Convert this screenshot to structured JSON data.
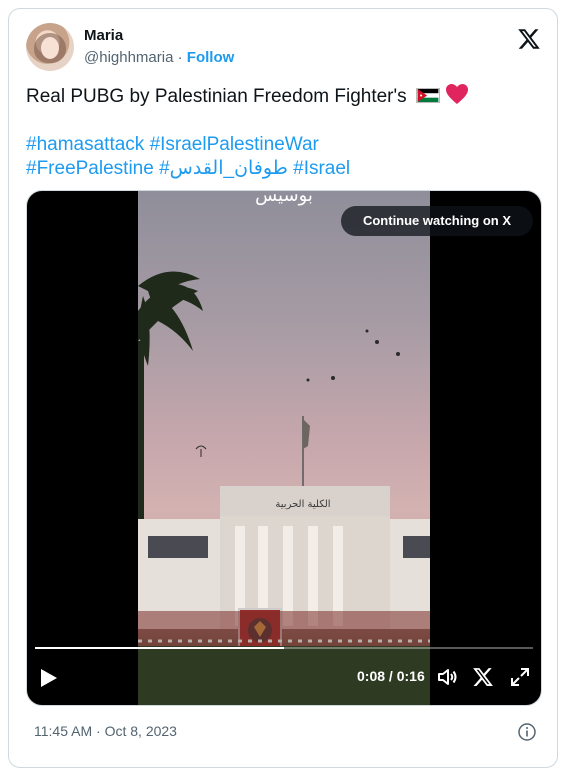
{
  "author": {
    "name": "Maria",
    "handle": "@highhmaria",
    "separator": "·",
    "follow_label": "Follow"
  },
  "icons": {
    "platform_logo": "x-logo-icon",
    "flag": "jordan-flag-icon",
    "heart": "red-heart-icon",
    "play": "play-icon",
    "volume": "volume-icon",
    "x_watermark": "x-logo-icon",
    "fullscreen": "fullscreen-icon",
    "info": "info-icon"
  },
  "tweet": {
    "text": "Real PUBG by  Palestinian Freedom Fighter's",
    "hashtags_line1": "#hamasattack #IsraelPalestineWar",
    "hashtags_line2": "#FreePalestine #طوفان_القدس #Israel"
  },
  "media": {
    "overlay_label": "Continue watching on X",
    "current_time": "0:08",
    "duration": "0:16",
    "time_separator": " / ",
    "progress": 0.5,
    "caption_arabic": "بوسيس",
    "building_sign": "الكلية الحربية"
  },
  "footer": {
    "time": "11:45 AM",
    "separator": "·",
    "date": "Oct 8, 2023"
  },
  "colors": {
    "accent": "#1d9bf0",
    "text": "#0f1419",
    "muted": "#536471",
    "border": "#cfd9de",
    "heart": "#e0245e"
  }
}
